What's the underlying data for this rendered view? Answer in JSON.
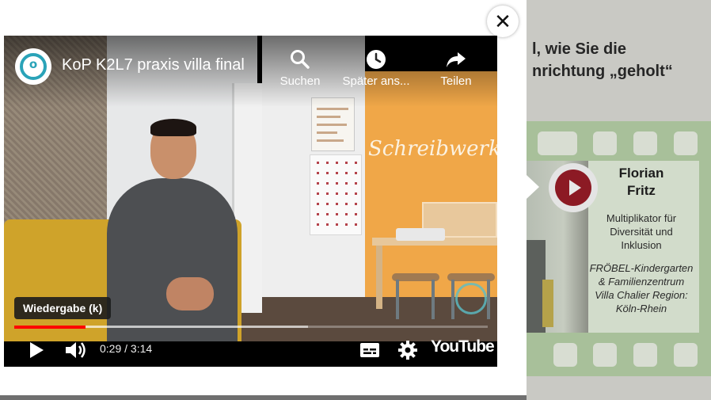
{
  "background_page": {
    "heading_lines": [
      "l, wie Sie die",
      "nrichtung „geholt“"
    ],
    "profile": {
      "name_lines": [
        "Florian",
        "Fritz"
      ],
      "role": "Multiplikator für Diversität und Inklusion",
      "organization": "FRÖBEL-Kindergarten & Familienzentrum Villa Chalier Region: Köln-Rhein"
    },
    "colors": {
      "filmstrip": "#a8c09a",
      "play_badge": "#8c1a24"
    }
  },
  "modal": {
    "close_glyph": "✕"
  },
  "player": {
    "title": "KoP K2L7 praxis villa final",
    "channel_logo_mark": "o",
    "video_scribble": "Schreibwerkst",
    "top_actions": [
      {
        "icon": "search-icon",
        "label": "Suchen"
      },
      {
        "icon": "clock-icon",
        "label": "Später ans..."
      },
      {
        "icon": "share-icon",
        "label": "Teilen"
      }
    ],
    "tooltip": "Wiedergabe (k)",
    "time": "0:29 / 3:14",
    "progress": {
      "played_fraction": 0.15,
      "loaded_fraction": 0.62
    },
    "brand": "YouTube",
    "colors": {
      "progress": "#ff0000",
      "logo_accent": "#2aa3b8"
    }
  }
}
